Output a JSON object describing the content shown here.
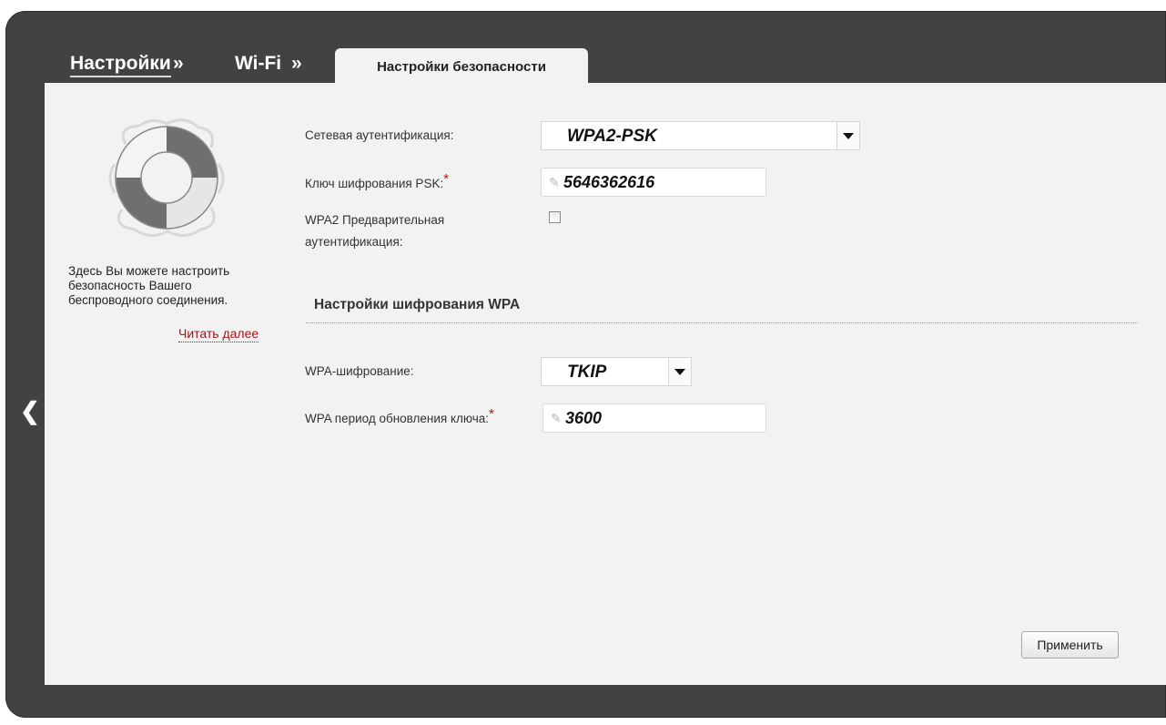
{
  "breadcrumb": {
    "settings": "Настройки",
    "wifi": "Wi-Fi",
    "separator": "»"
  },
  "tab": {
    "label": "Настройки безопасности"
  },
  "help": {
    "text": "Здесь Вы можете настроить безопасность Вашего беспроводного соединения.",
    "read_more": "Читать далее",
    "icon": "lifebuoy-icon"
  },
  "form": {
    "auth_label": "Сетевая аутентификация:",
    "auth_value": "WPA2-PSK",
    "psk_label": "Ключ шифрования PSK:",
    "psk_value": "5646362616",
    "preauth_label_line1": "WPA2 Предварительная",
    "preauth_label_line2": "аутентификация:",
    "preauth_checked": false,
    "required_mark": "*"
  },
  "wpa_section": {
    "title": "Настройки шифрования WPA",
    "encryption_label": "WPA-шифрование:",
    "encryption_value": "TKIP",
    "rekey_label": "WPA период обновления ключа:",
    "rekey_value": "3600"
  },
  "actions": {
    "apply_label": "Применить"
  },
  "colors": {
    "frame": "#424242",
    "panel": "#f2f2f2",
    "required": "#d10a0a",
    "link": "#a3141b"
  }
}
